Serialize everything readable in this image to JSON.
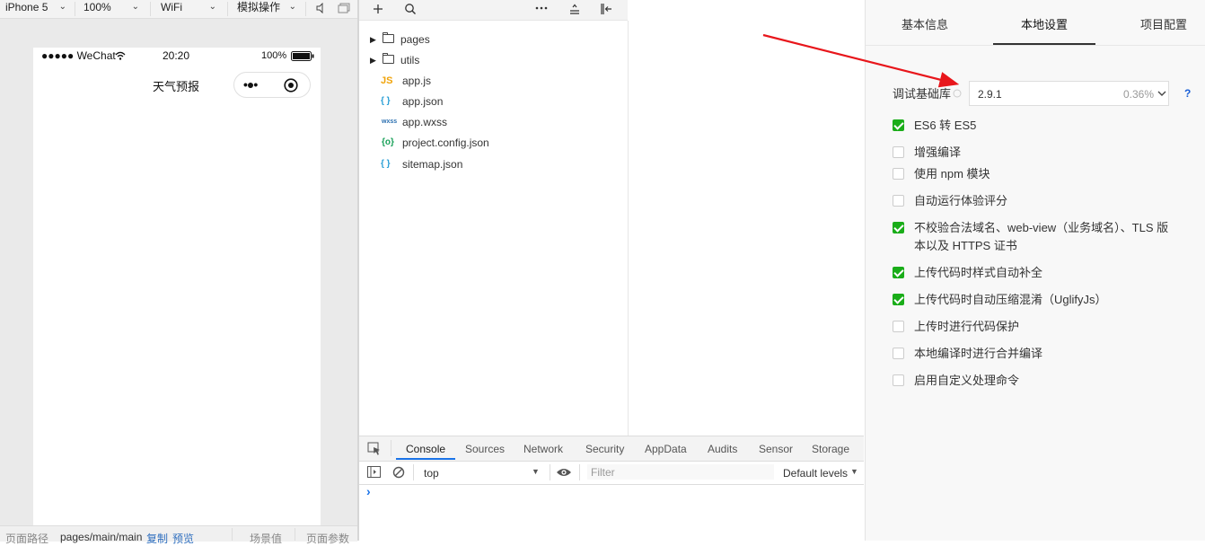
{
  "simulator": {
    "toolbar": {
      "device": "iPhone 5",
      "zoom": "100%",
      "network": "WiFi",
      "operation": "模拟操作"
    },
    "status_bar": {
      "carrier": "●●●●● WeChat",
      "time": "20:20",
      "battery": "100%"
    },
    "nav_title": "天气预报",
    "capsule_more": "•●•",
    "bottom_bar": {
      "path_label": "页面路径",
      "path_value": "pages/main/main",
      "copy": "复制",
      "preview": "预览",
      "scene": "场景值",
      "params": "页面参数"
    }
  },
  "file_tree": {
    "folders": [
      {
        "name": "pages"
      },
      {
        "name": "utils"
      }
    ],
    "files": [
      {
        "name": "app.js",
        "icon": "JS",
        "color": "#f0a30a"
      },
      {
        "name": "app.json",
        "icon": "{ }",
        "color": "#2a9fd6"
      },
      {
        "name": "app.wxss",
        "icon": "wxss",
        "color": "#2a6fb0"
      },
      {
        "name": "project.config.json",
        "icon": "{o}",
        "color": "#18a058"
      },
      {
        "name": "sitemap.json",
        "icon": "{ }",
        "color": "#2a9fd6"
      }
    ]
  },
  "console": {
    "tabs": [
      "Console",
      "Sources",
      "Network",
      "Security",
      "AppData",
      "Audits",
      "Sensor",
      "Storage"
    ],
    "active_tab": "Console",
    "context": "top",
    "filter_placeholder": "Filter",
    "levels": "Default levels",
    "prompt": "›"
  },
  "settings": {
    "tabs": [
      "基本信息",
      "本地设置",
      "项目配置"
    ],
    "active_tab": "本地设置",
    "lib_label": "调试基础库",
    "lib_version": "2.9.1",
    "lib_percent": "0.36%",
    "help": "?",
    "options": [
      {
        "label": "ES6 转 ES5",
        "checked": true
      },
      {
        "label": "增强编译",
        "checked": false
      },
      {
        "label": "使用 npm 模块",
        "checked": false
      },
      {
        "label": "自动运行体验评分",
        "checked": false
      },
      {
        "label": "不校验合法域名、web-view（业务域名）、TLS 版",
        "label2": "本以及 HTTPS 证书",
        "checked": true
      },
      {
        "label": "上传代码时样式自动补全",
        "checked": true
      },
      {
        "label": "上传代码时自动压缩混淆（UglifyJs）",
        "checked": true
      },
      {
        "label": "上传时进行代码保护",
        "checked": false
      },
      {
        "label": "本地编译时进行合并编译",
        "checked": false
      },
      {
        "label": "启用自定义处理命令",
        "checked": false
      }
    ]
  },
  "colors": {
    "accent_green": "#1aad19",
    "annotation_arrow": "#e8161b",
    "link_blue": "#2f6fbf"
  }
}
